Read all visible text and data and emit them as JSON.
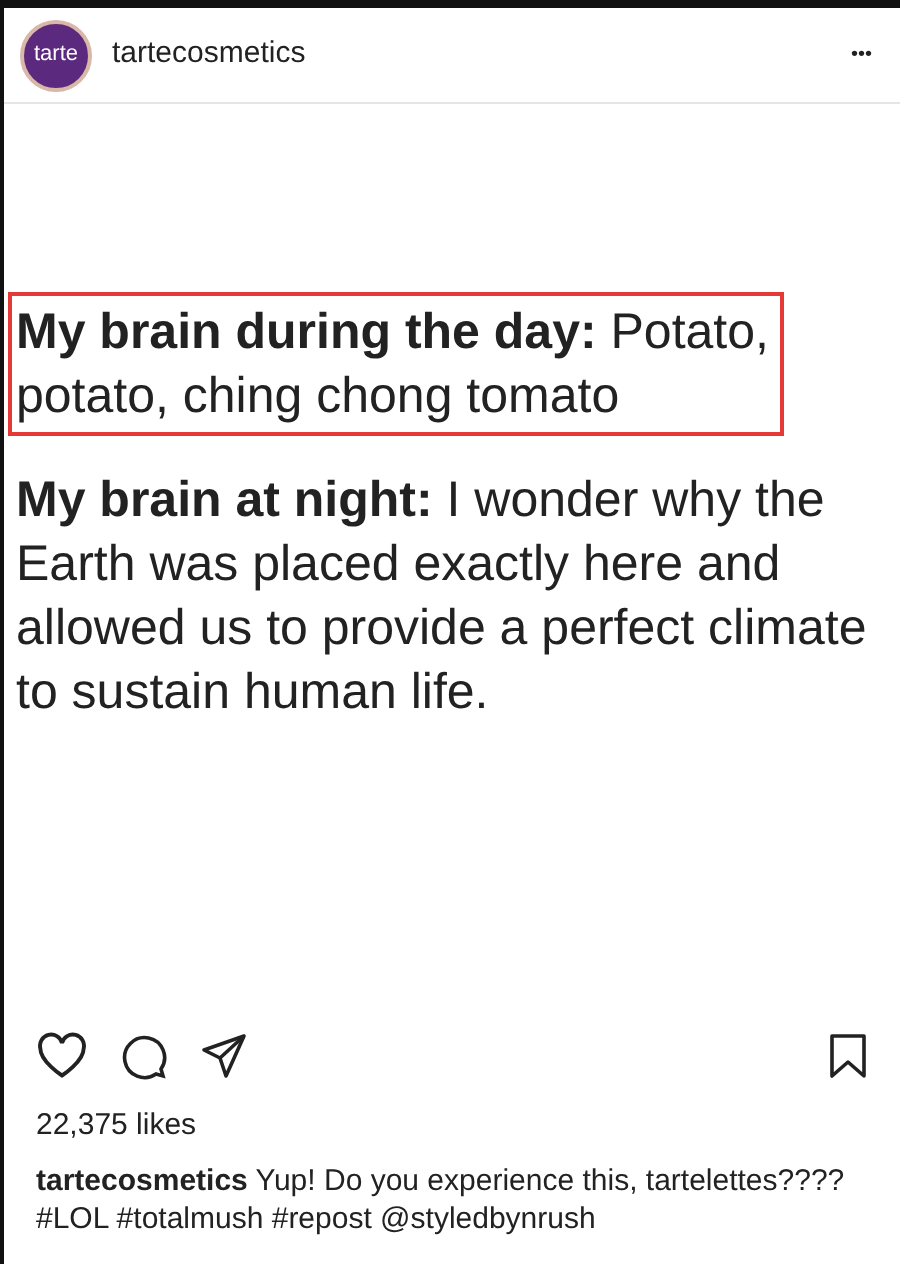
{
  "post": {
    "avatar_text": "tarte",
    "username": "tartecosmetics",
    "more": "•••"
  },
  "meme": [
    {
      "text": "**My brain during the day:** Potato, potato, ching chong tomato",
      "highlighted": true
    },
    {
      "text": "**My brain at night:** I wonder why the Earth was placed exactly here and allowed us to provide a perfect climate to sustain human life.",
      "highlighted": false
    }
  ],
  "likes": "22,375 likes",
  "caption": "**tartecosmetics** Yup! Do you experience this, tartelettes???? #LOL #totalmush #repost @styledbynrush"
}
